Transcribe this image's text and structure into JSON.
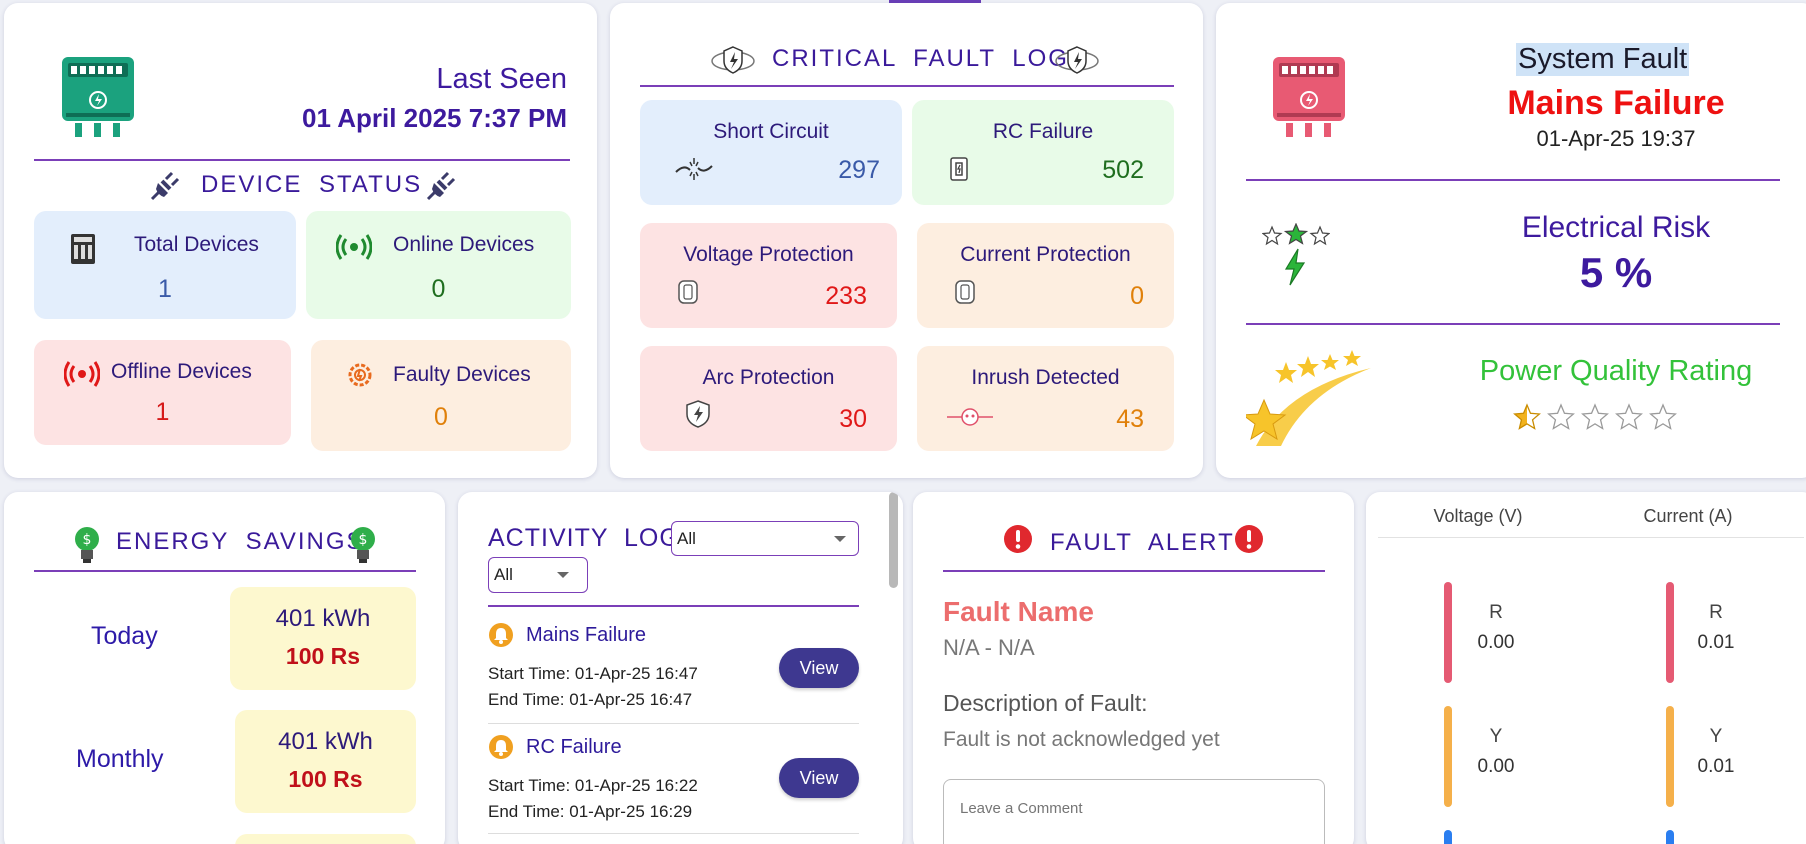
{
  "top_accent_color": "#6a3fb8",
  "device_card": {
    "last_seen_label": "Last Seen",
    "last_seen_value": "01 April 2025 7:37 PM",
    "device_status_title": "DEVICE STATUS",
    "total_devices": {
      "label": "Total Devices",
      "value": "1"
    },
    "online_devices": {
      "label": "Online Devices",
      "value": "0"
    },
    "offline_devices": {
      "label": "Offline Devices",
      "value": "1"
    },
    "faulty_devices": {
      "label": "Faulty Devices",
      "value": "0"
    }
  },
  "critical_fault_log": {
    "title": "CRITICAL FAULT LOG",
    "items": [
      {
        "label": "Short Circuit",
        "value": "297",
        "icon": "short-circuit-icon"
      },
      {
        "label": "RC Failure",
        "value": "502",
        "icon": "rc-failure-icon"
      },
      {
        "label": "Voltage Protection",
        "value": "233",
        "icon": "voltage-protection-icon"
      },
      {
        "label": "Current Protection",
        "value": "0",
        "icon": "current-protection-icon"
      },
      {
        "label": "Arc Protection",
        "value": "30",
        "icon": "arc-protection-icon"
      },
      {
        "label": "Inrush Detected",
        "value": "43",
        "icon": "inrush-icon"
      }
    ]
  },
  "system_card": {
    "system_fault_label": "System Fault",
    "fault_name": "Mains Failure",
    "fault_time": "01-Apr-25 19:37",
    "electrical_risk_label": "Electrical Risk",
    "electrical_risk_value": "5 %",
    "power_quality_label": "Power Quality Rating",
    "power_quality_rating": 0.5,
    "power_quality_max": 5
  },
  "energy_savings": {
    "title": "ENERGY SAVINGS",
    "rows": [
      {
        "label": "Today",
        "energy": "401 kWh",
        "cost": "100 Rs"
      },
      {
        "label": "Monthly",
        "energy": "401 kWh",
        "cost": "100 Rs"
      }
    ]
  },
  "activity_log": {
    "title": "ACTIVITY LOG",
    "filter1": "All",
    "filter2": "All",
    "entries": [
      {
        "name": "Mains Failure",
        "start": "Start Time: 01-Apr-25 16:47",
        "end": "End Time: 01-Apr-25 16:47",
        "button": "View"
      },
      {
        "name": "RC Failure",
        "start": "Start Time: 01-Apr-25 16:22",
        "end": "End Time: 01-Apr-25 16:29",
        "button": "View"
      }
    ]
  },
  "fault_alert": {
    "title": "FAULT ALERT",
    "fault_name_label": "Fault Name",
    "fault_name_value": "N/A - N/A",
    "description_label": "Description of Fault:",
    "description_value": "Fault is not acknowledged yet",
    "comment_placeholder": "Leave a Comment"
  },
  "readings": {
    "voltage_header": "Voltage (V)",
    "current_header": "Current (A)",
    "voltage": [
      {
        "phase": "R",
        "value": "0.00",
        "color": "#e55a73"
      },
      {
        "phase": "Y",
        "value": "0.00",
        "color": "#f5b04a"
      }
    ],
    "current": [
      {
        "phase": "R",
        "value": "0.01",
        "color": "#e55a73"
      },
      {
        "phase": "Y",
        "value": "0.01",
        "color": "#f5b04a"
      }
    ],
    "b_phase_color": "#2a7ef0"
  }
}
